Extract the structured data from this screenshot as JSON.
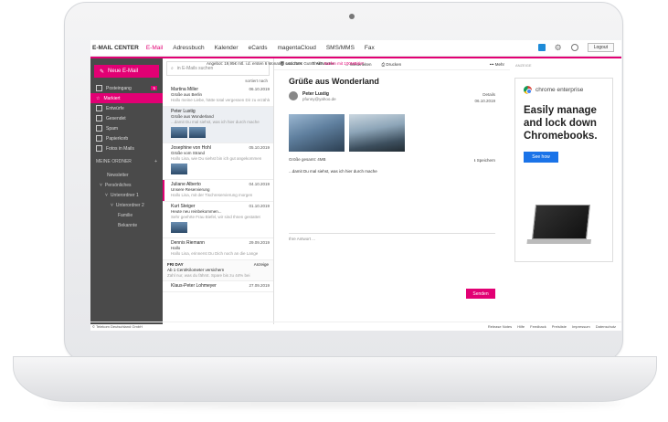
{
  "header": {
    "brand": "E-MAIL CENTER",
    "nav": [
      "E-Mail",
      "Adressbuch",
      "Kalender",
      "eCards",
      "magentaCloud",
      "SMS/MMS",
      "Fax"
    ],
    "active_nav": "E-Mail",
    "logout": "Logout"
  },
  "promo": {
    "prefix": "Angebot: 19,95€ mtl. i.d. ersten 6 Monaten und 210€ Gutschrift*",
    "highlight": "Surfen mit 100MBit/s*"
  },
  "sidebar": {
    "new_mail": "Neue E-Mail",
    "folders": [
      {
        "label": "Posteingang",
        "badge": "5"
      },
      {
        "label": "Markiert"
      },
      {
        "label": "Entwürfe"
      },
      {
        "label": "Gesendet"
      },
      {
        "label": "Spam"
      },
      {
        "label": "Papierkorb"
      },
      {
        "label": "Fotos in Mails"
      }
    ],
    "my_folders": "MEINE ORDNER",
    "subfolders": [
      "Newsletter",
      "Persönliches",
      "Unterordner 1",
      "Unterordner 2",
      "Familie",
      "Bekannte"
    ]
  },
  "list": {
    "search_placeholder": "in E-Mails suchen",
    "sorted": "sortiert nach",
    "messages": [
      {
        "from": "Martina Miller",
        "date": "06.10.2019",
        "subject": "Grüße aus Berlin",
        "preview": "Hallo meine Liebe, hätte total vergessen Dir zu erzählen"
      },
      {
        "from": "Peter Lustig",
        "date": "",
        "subject": "Grüße aus Wonderland",
        "preview": "...damit Du mal siehst, was ich hier durch mache"
      },
      {
        "from": "Josephine von Hohl",
        "date": "05.10.2019",
        "subject": "Grüße vom Strand",
        "preview": "Hallo Lisa, wie Du siehst bin ich gut angekommen"
      },
      {
        "from": "Juliane Alberto",
        "date": "04.10.2019",
        "subject": "Unsere Reservierung",
        "preview": "Hallo Lisa, mit der Tischreservierung morgen"
      },
      {
        "from": "Kurt Steiger",
        "date": "01.10.2019",
        "subject": "Heute neu reinbekommen...",
        "preview": "Sehr geehrte Frau Biefel, wir sind Ihnen gestattet"
      },
      {
        "from": "Dennis Riemann",
        "date": "29.09.2019",
        "subject": "Hallo",
        "preview": "Hallo Lisa, erinnerst Du Dich noch an die Lange"
      }
    ],
    "ad": {
      "brand": "FRI DAY",
      "label": "Anzeige",
      "title": "Ab 1 Cent/Kilometer versichern",
      "text": "Zahl nur, was du fährst. Spare bis zu 44% bei"
    },
    "last": {
      "from": "Klaus-Peter Lohmeyer",
      "date": "27.09.2019"
    }
  },
  "toolbar": {
    "delete": "Löschen",
    "reply": "Antworten",
    "forward": "Weiterleiten",
    "print": "Drucken",
    "more": "Mehr"
  },
  "message": {
    "subject": "Grüße aus Wonderland",
    "sender_name": "Peter Lustig",
    "sender_email": "pfunny@yahoo.de",
    "details": "Details",
    "date": "06.10.2019",
    "size": "Größe gesamt: 4MB",
    "save": "Speichern",
    "body": "...damit Du mal siehst, was ich hier durch mache",
    "reply_placeholder": "Ihre Antwort ...",
    "send": "Senden"
  },
  "ad": {
    "label": "ANZEIGE",
    "logo": "chrome enterprise",
    "headline": "Easily manage and lock down Chromebooks.",
    "cta": "See how"
  },
  "footer": {
    "copyright": "© Telekom Deutschland GmbH",
    "links": [
      "Release Notes",
      "Hilfe",
      "Feedback",
      "Preisliste",
      "Impressum",
      "Datenschutz"
    ]
  }
}
